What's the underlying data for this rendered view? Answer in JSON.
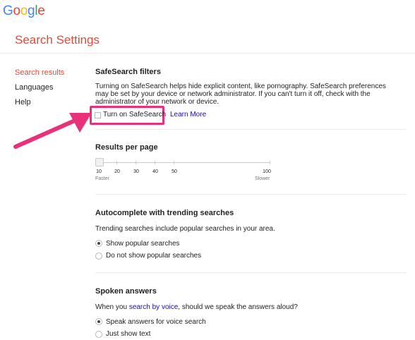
{
  "logo": [
    "G",
    "o",
    "o",
    "g",
    "l",
    "e"
  ],
  "page_title": "Search Settings",
  "sidebar": {
    "items": [
      {
        "label": "Search results"
      },
      {
        "label": "Languages"
      },
      {
        "label": "Help"
      }
    ]
  },
  "safesearch": {
    "title": "SafeSearch filters",
    "description": "Turning on SafeSearch helps hide explicit content, like pornography. SafeSearch preferences may be set by your device or network administrator. If you can't turn it off, check with the administrator of your network or device.",
    "checkbox_label": "Turn on SafeSearch",
    "checked": false,
    "learn_more": "Learn More"
  },
  "results_per_page": {
    "title": "Results per page",
    "ticks": [
      "10",
      "20",
      "30",
      "40",
      "50",
      "100"
    ],
    "selected": "10",
    "faster": "Faster",
    "slower": "Slower"
  },
  "autocomplete": {
    "title": "Autocomplete with trending searches",
    "description": "Trending searches include popular searches in your area.",
    "options": [
      {
        "label": "Show popular searches",
        "checked": true
      },
      {
        "label": "Do not show popular searches",
        "checked": false
      }
    ]
  },
  "spoken": {
    "title": "Spoken answers",
    "description_prefix": "When you ",
    "description_link": "search by voice",
    "description_suffix": ", should we speak the answers aloud?",
    "options": [
      {
        "label": "Speak answers for voice search",
        "checked": true
      },
      {
        "label": "Just show text",
        "checked": false
      }
    ]
  },
  "colors": {
    "accent_red": "#dd4b39",
    "highlight_pink": "#e8317a",
    "link_blue": "#1a0dab"
  }
}
